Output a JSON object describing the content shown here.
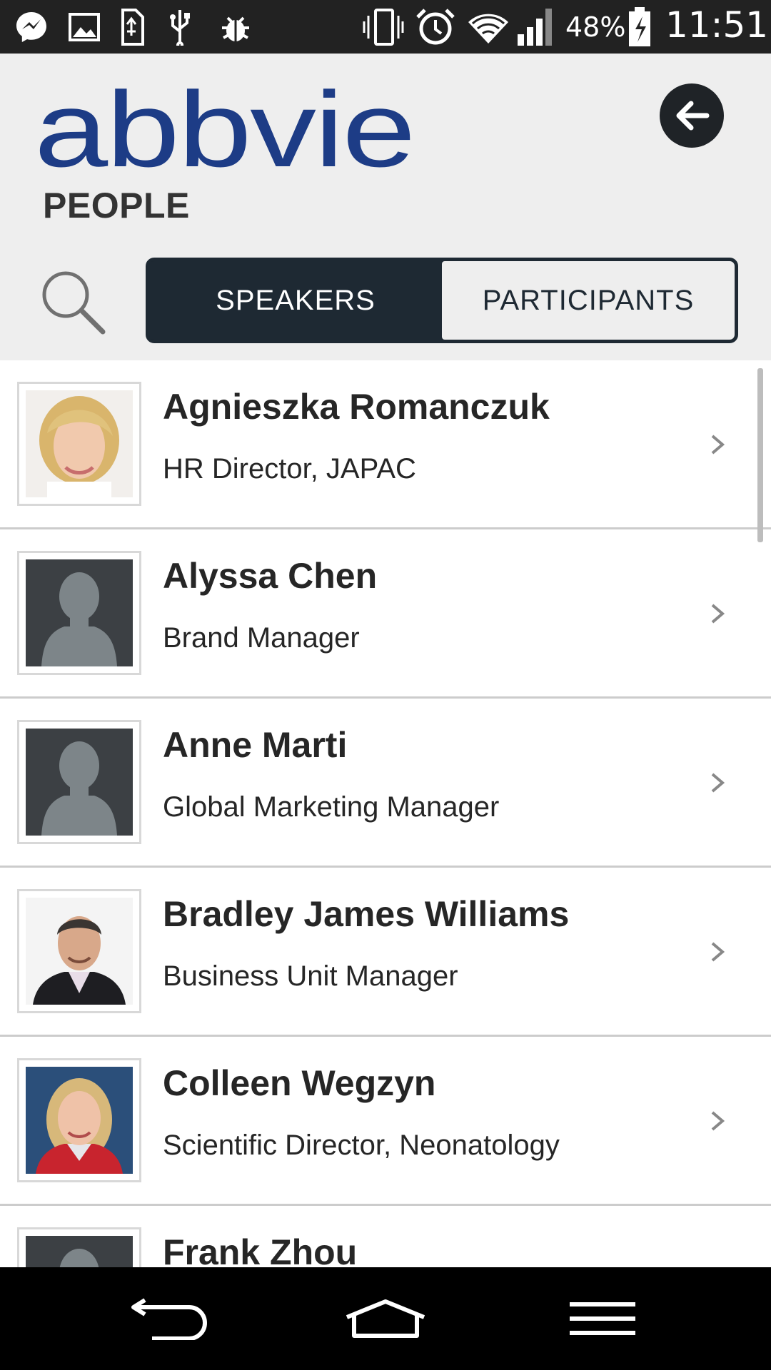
{
  "status_bar": {
    "battery_percent": "48%",
    "time": "11:51",
    "icons": [
      "messenger-icon",
      "gallery-icon",
      "sd-card-icon",
      "usb-icon",
      "debug-icon",
      "vibrate-icon",
      "alarm-icon",
      "wifi-icon",
      "signal-icon",
      "battery-charging-icon"
    ]
  },
  "header": {
    "logo_text": "abbvie",
    "title": "PEOPLE",
    "back_icon": "arrow-left-icon",
    "search_icon": "search-icon"
  },
  "tabs": [
    {
      "label": "SPEAKERS",
      "active": true
    },
    {
      "label": "PARTICIPANTS",
      "active": false
    }
  ],
  "people": [
    {
      "name": "Agnieszka Romanczuk",
      "role": "HR Director, JAPAC",
      "photo": "photo-woman-blonde"
    },
    {
      "name": "Alyssa Chen",
      "role": "Brand Manager",
      "photo": "placeholder-silhouette"
    },
    {
      "name": "Anne Marti",
      "role": "Global Marketing Manager",
      "photo": "placeholder-silhouette"
    },
    {
      "name": "Bradley James Williams",
      "role": "Business Unit Manager",
      "photo": "photo-man-suit"
    },
    {
      "name": "Colleen Wegzyn",
      "role": "Scientific Director, Neonatology",
      "photo": "photo-woman-red"
    },
    {
      "name": "Frank Zhou",
      "role": "",
      "photo": "placeholder-silhouette"
    }
  ],
  "nav_bar": {
    "icons": [
      "back-nav-icon",
      "home-nav-icon",
      "menu-nav-icon"
    ]
  },
  "colors": {
    "dark": "#1e2933",
    "header_bg": "#eeeeee",
    "logo_blue": "#1d3c86"
  }
}
